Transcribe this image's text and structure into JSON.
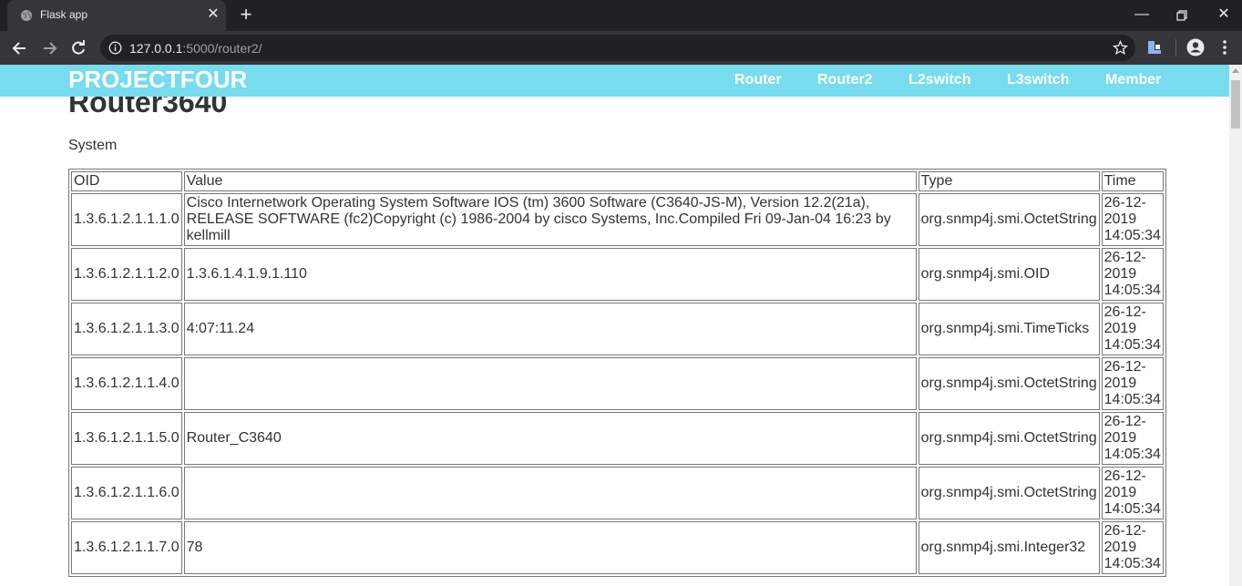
{
  "browser": {
    "tab_title": "Flask app",
    "url_host": "127.0.0.1",
    "url_path": ":5000/router2/"
  },
  "navbar": {
    "brand": "PROJECTFOUR",
    "links": [
      "Router",
      "Router2",
      "L2switch",
      "L3switch",
      "Member"
    ]
  },
  "page": {
    "title": "Router3640",
    "section": "System"
  },
  "table": {
    "headers": [
      "OID",
      "Value",
      "Type",
      "Time"
    ],
    "rows": [
      {
        "oid": "1.3.6.1.2.1.1.1.0",
        "value": "Cisco Internetwork Operating System Software IOS (tm) 3600 Software (C3640-JS-M), Version 12.2(21a), RELEASE SOFTWARE (fc2)Copyright (c) 1986-2004 by cisco Systems, Inc.Compiled Fri 09-Jan-04 16:23 by kellmill",
        "type": "org.snmp4j.smi.OctetString",
        "time": "26-12-\n2019\n14:05:34"
      },
      {
        "oid": "1.3.6.1.2.1.1.2.0",
        "value": "1.3.6.1.4.1.9.1.110",
        "type": "org.snmp4j.smi.OID",
        "time": "26-12-\n2019\n14:05:34"
      },
      {
        "oid": "1.3.6.1.2.1.1.3.0",
        "value": "4:07:11.24",
        "type": "org.snmp4j.smi.TimeTicks",
        "time": "26-12-\n2019\n14:05:34"
      },
      {
        "oid": "1.3.6.1.2.1.1.4.0",
        "value": "",
        "type": "org.snmp4j.smi.OctetString",
        "time": "26-12-\n2019\n14:05:34"
      },
      {
        "oid": "1.3.6.1.2.1.1.5.0",
        "value": "Router_C3640",
        "type": "org.snmp4j.smi.OctetString",
        "time": "26-12-\n2019\n14:05:34"
      },
      {
        "oid": "1.3.6.1.2.1.1.6.0",
        "value": "",
        "type": "org.snmp4j.smi.OctetString",
        "time": "26-12-\n2019\n14:05:34"
      },
      {
        "oid": "1.3.6.1.2.1.1.7.0",
        "value": "78",
        "type": "org.snmp4j.smi.Integer32",
        "time": "26-12-\n2019\n14:05:34"
      }
    ]
  },
  "colors": {
    "navbar_bg": "#76dcee",
    "chrome_dark": "#202124",
    "chrome_toolbar": "#35363a"
  }
}
